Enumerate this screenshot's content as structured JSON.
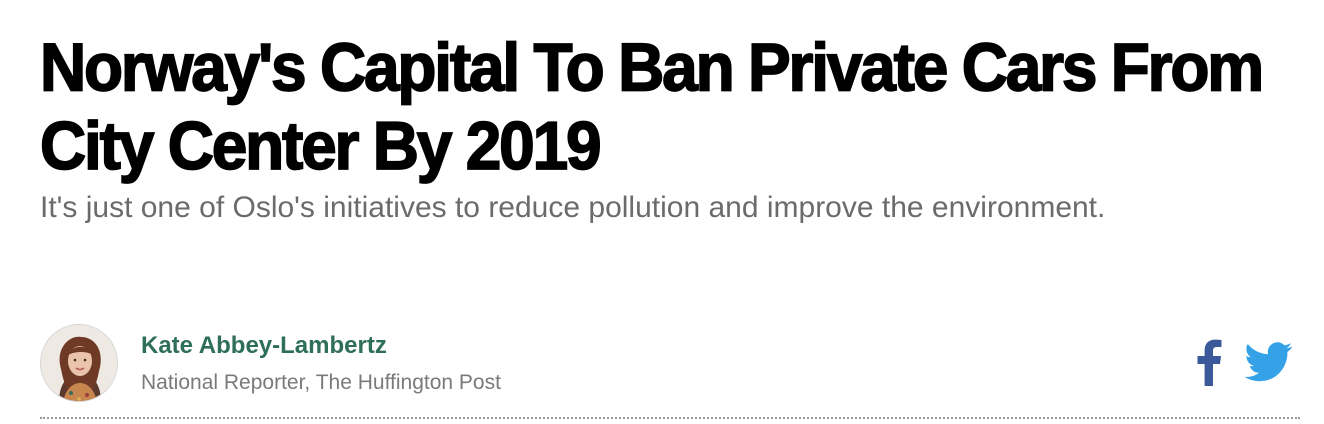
{
  "article": {
    "headline": "Norway's Capital To Ban Private Cars From City Center By 2019",
    "subhead": "It's just one of Oslo's initiatives to reduce pollution and improve the environment."
  },
  "author": {
    "name": "Kate Abbey-Lambertz",
    "title": "National Reporter, The Huffington Post",
    "avatar_icon": "author-photo"
  },
  "share": {
    "facebook_icon": "facebook-icon",
    "twitter_icon": "twitter-icon"
  },
  "colors": {
    "headline": "#000000",
    "subhead": "#6b6b6b",
    "author_name": "#2e6e5a",
    "author_title": "#7a7a7a",
    "facebook": "#3b5998",
    "twitter": "#35a2e8"
  }
}
